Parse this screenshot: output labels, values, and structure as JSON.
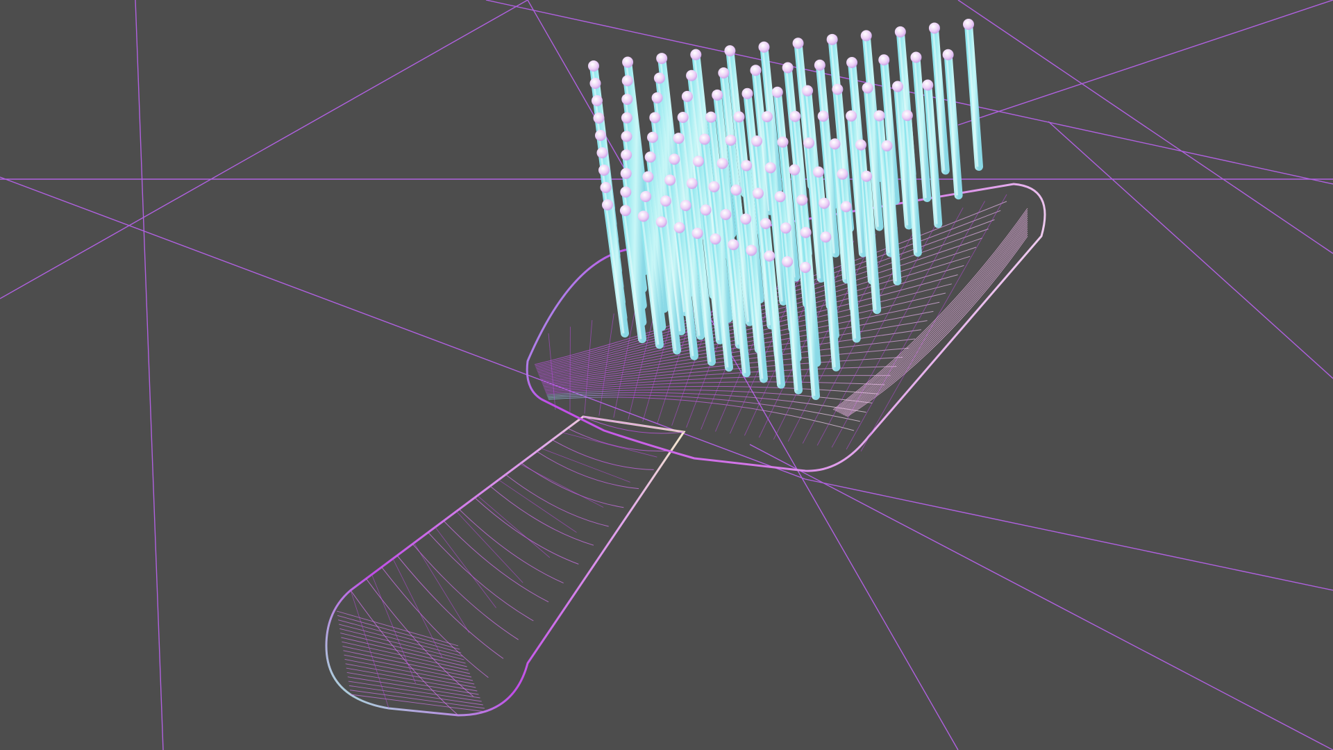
{
  "scene": {
    "background_color": "#4d4d4d",
    "grid_color": "#b061e0",
    "subject": "hairbrush-wireframe-render",
    "mesh_colors": {
      "magenta": "#c04ce8",
      "violet": "#9a5df0",
      "pink": "#f2b8ec",
      "cream": "#f6f1c9",
      "mint": "#a8f0d8",
      "cyan": "#8fe6ee",
      "pin_body": "#a9f1f2",
      "pin_tip": "#ecd0f6"
    },
    "render_mode": "wireframe",
    "bristle_rows": 9,
    "bristle_cols": 12
  }
}
